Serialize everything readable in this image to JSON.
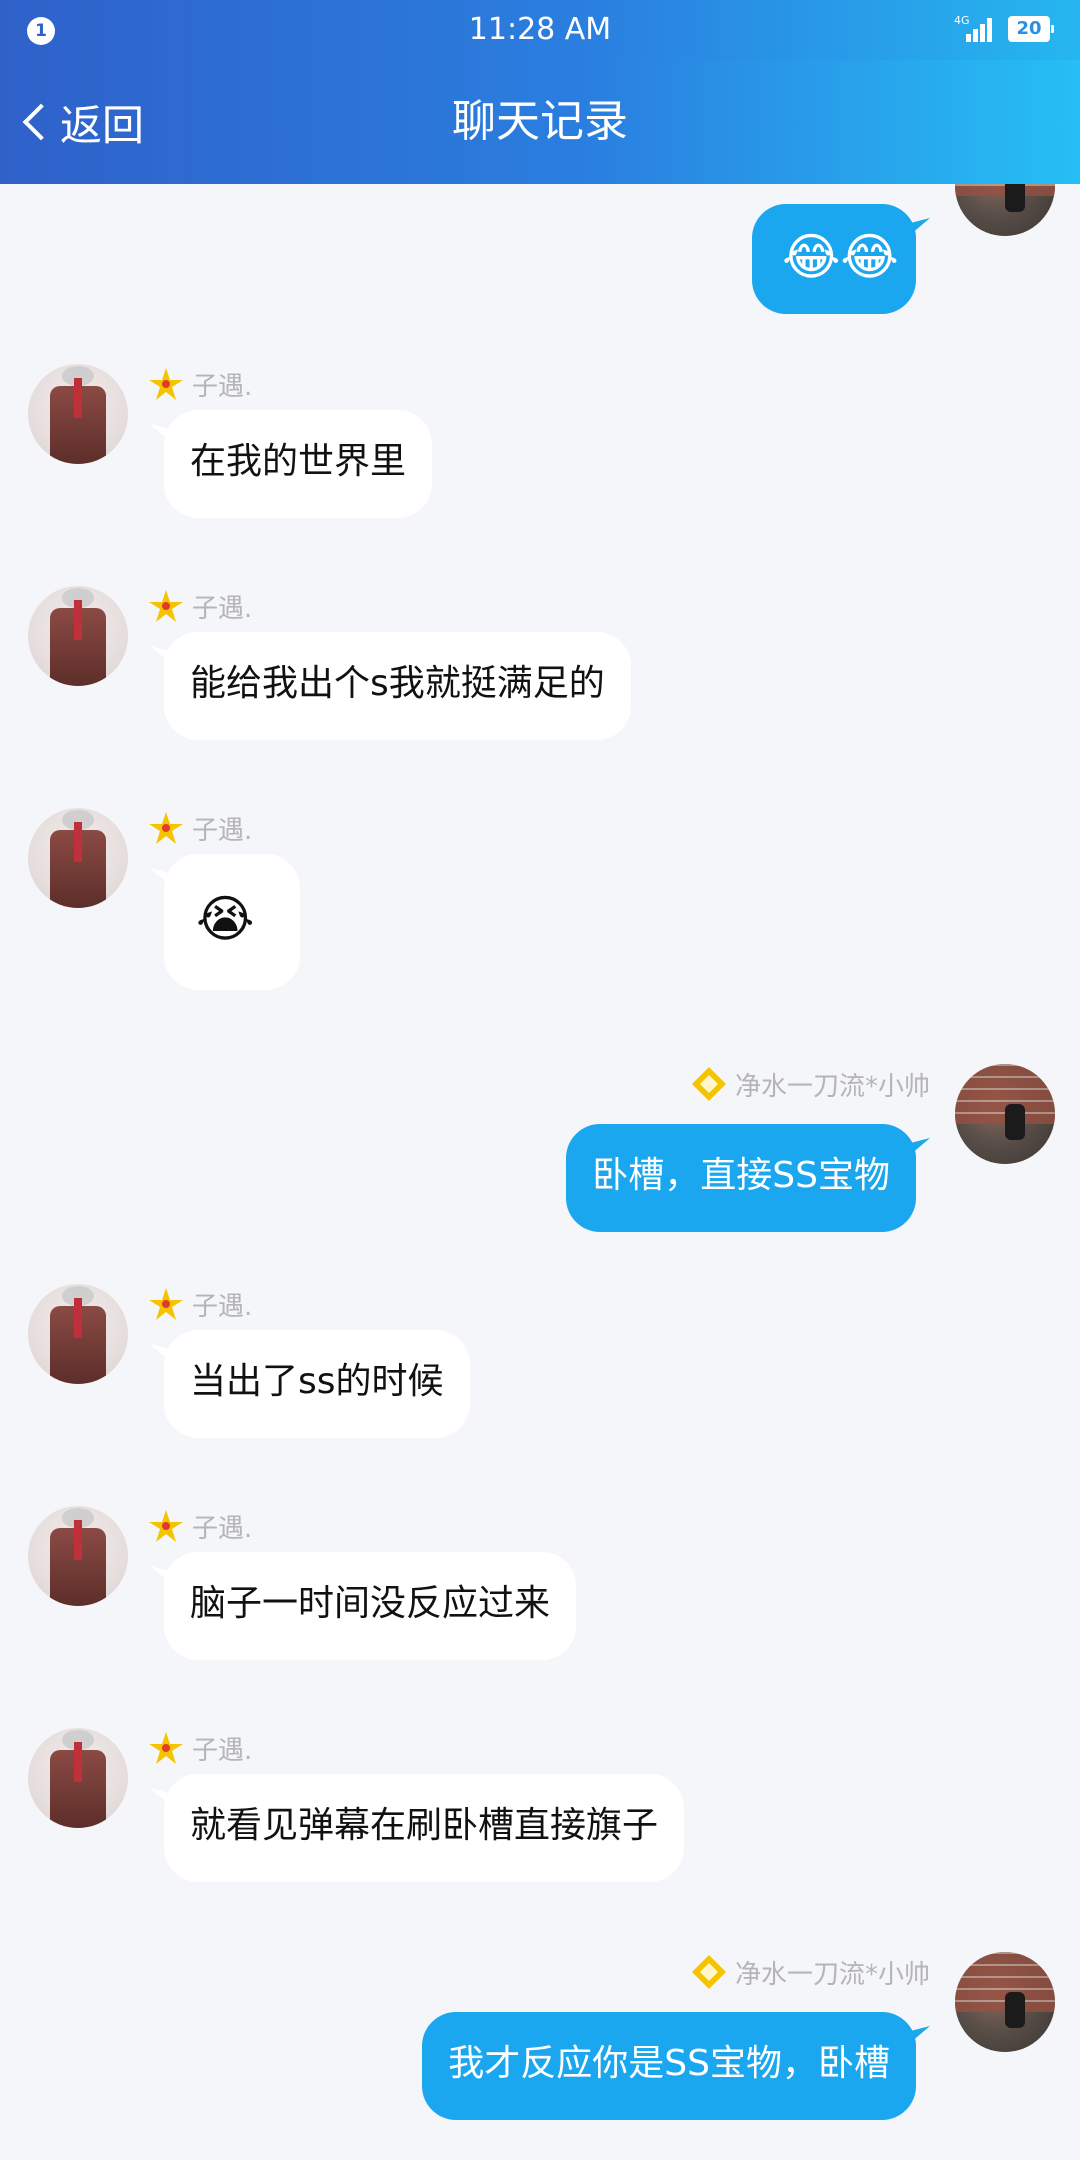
{
  "status_bar": {
    "notification_count": "1",
    "time": "11:28 AM",
    "network": "4G",
    "battery": "20"
  },
  "header": {
    "back_label": "返回",
    "title": "聊天记录"
  },
  "messages": [
    {
      "side": "right",
      "sender": "",
      "text": "😂😂"
    },
    {
      "side": "left",
      "sender": "子遇.",
      "text": "在我的世界里"
    },
    {
      "side": "left",
      "sender": "子遇.",
      "text": "能给我出个s我就挺满足的"
    },
    {
      "side": "left",
      "sender": "子遇.",
      "text": "😭"
    },
    {
      "side": "right",
      "sender": "净水一刀流*小帅",
      "text": "卧槽，直接SS宝物"
    },
    {
      "side": "left",
      "sender": "子遇.",
      "text": "当出了ss的时候"
    },
    {
      "side": "left",
      "sender": "子遇.",
      "text": "脑子一时间没反应过来"
    },
    {
      "side": "left",
      "sender": "子遇.",
      "text": "就看见弹幕在刷卧槽直接旗子"
    },
    {
      "side": "right",
      "sender": "净水一刀流*小帅",
      "text": "我才反应你是SS宝物，卧槽"
    }
  ],
  "colors": {
    "accent": "#1aa7ef",
    "header_start": "#2f61c9",
    "header_end": "#26bff4",
    "rank_left": "#f5c400",
    "rank_right": "#f5c400"
  }
}
